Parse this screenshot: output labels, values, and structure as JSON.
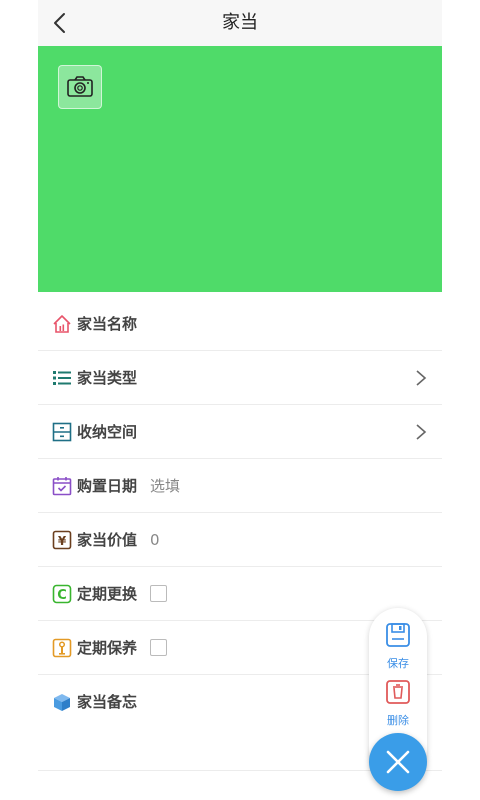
{
  "header": {
    "title": "家当"
  },
  "cover": {
    "color": "#4fdb69"
  },
  "fields": {
    "name": {
      "label": "家当名称"
    },
    "type": {
      "label": "家当类型"
    },
    "storage": {
      "label": "收纳空间"
    },
    "purchase_date": {
      "label": "购置日期",
      "placeholder": "选填"
    },
    "value": {
      "label": "家当价值",
      "value": "0"
    },
    "periodic_replace": {
      "label": "定期更换"
    },
    "periodic_maintain": {
      "label": "定期保养"
    },
    "memo": {
      "label": "家当备忘"
    }
  },
  "fab": {
    "save_label": "保存",
    "delete_label": "删除"
  },
  "colors": {
    "accent_blue": "#3a9de8",
    "delete_red": "#e05a5a",
    "icon_red": "#e8546a",
    "icon_teal": "#1f7a6f",
    "icon_purple": "#8a4fc7",
    "icon_brown": "#6b3f1f",
    "icon_green": "#39b52f",
    "icon_orange": "#e39a26",
    "icon_blue": "#4a9be0"
  }
}
